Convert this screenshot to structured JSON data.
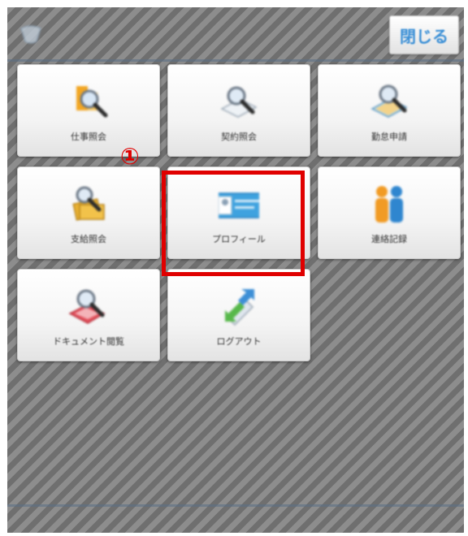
{
  "header": {
    "app_title": "",
    "close_label": "閉じる"
  },
  "menu": {
    "tiles": [
      {
        "label": "仕事照会",
        "icon": "job-search-icon"
      },
      {
        "label": "契約照会",
        "icon": "contract-search-icon"
      },
      {
        "label": "勤怠申請",
        "icon": "attendance-request-icon"
      },
      {
        "label": "支給照会",
        "icon": "payment-search-icon"
      },
      {
        "label": "プロフィール",
        "icon": "profile-card-icon"
      },
      {
        "label": "連絡記録",
        "icon": "contacts-icon"
      },
      {
        "label": "ドキュメント閲覧",
        "icon": "document-view-icon"
      },
      {
        "label": "ログアウト",
        "icon": "logout-icon"
      }
    ]
  },
  "annotation": {
    "step_marker": "①",
    "highlight_color": "#e00000"
  }
}
